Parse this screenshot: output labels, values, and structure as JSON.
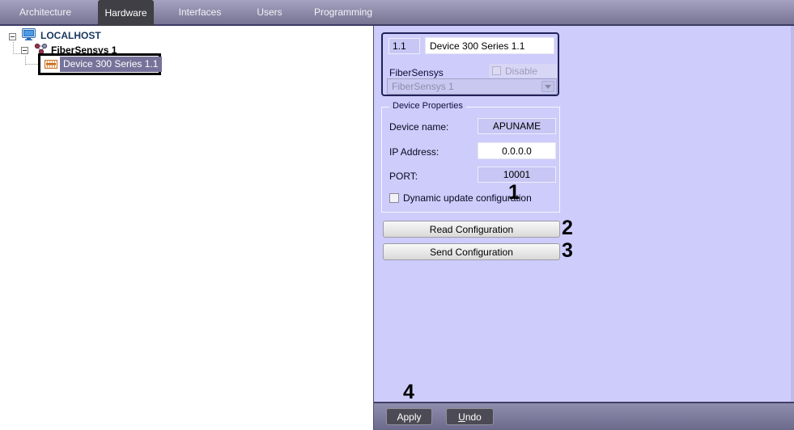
{
  "tabs": [
    {
      "label": "Architecture"
    },
    {
      "label": "Hardware"
    },
    {
      "label": "Interfaces"
    },
    {
      "label": "Users"
    },
    {
      "label": "Programming"
    }
  ],
  "active_tab": "Hardware",
  "tree": {
    "root": "LOCALHOST",
    "server": "FiberSensys 1",
    "device": "Device 300 Series 1.1"
  },
  "panel": {
    "id_field": "1.1",
    "name_field": "Device 300 Series 1.1",
    "module_label": "FiberSensys",
    "disable_checkbox_label": "Disable",
    "parent_dropdown_value": "FiberSensys 1",
    "group_title": "Device Properties",
    "device_name_label": "Device name:",
    "device_name_value": "APUNAME",
    "ip_label": "IP Address:",
    "ip_value": "0.0.0.0",
    "port_label": "PORT:",
    "port_value": "10001",
    "dynamic_update_label": "Dynamic update configuration",
    "read_config_button": "Read Configuration",
    "send_config_button": "Send Configuration"
  },
  "footer": {
    "apply_button": "Apply",
    "undo_accel": "U",
    "undo_rest": "ndo"
  },
  "annotations": {
    "dynamic_update": "1",
    "read_config": "2",
    "send_config": "3",
    "apply": "4"
  },
  "colors": {
    "panel_bg": "#cdccfb",
    "tabbar_top": "#a5a3c1",
    "tabbar_bottom": "#73718f",
    "active_tab_bg": "#403f45",
    "selection_bg": "#75739a",
    "tree_root_text": "#17375e",
    "annotation": "#000000"
  }
}
